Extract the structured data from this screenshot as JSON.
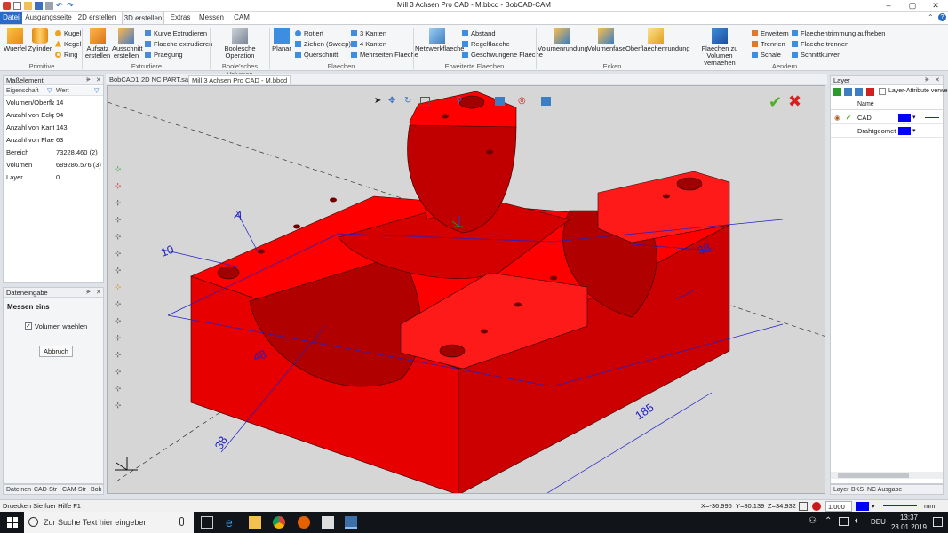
{
  "window": {
    "title": "Mill 3 Achsen Pro CAD - M.bbcd - BobCAD-CAM"
  },
  "ribbon_tabs": [
    "Datei",
    "Ausgangsseite",
    "2D erstellen",
    "3D erstellen",
    "Extras",
    "Messen",
    "CAM"
  ],
  "active_tab": "3D erstellen",
  "ribbon": {
    "primitive": {
      "label": "Primitive",
      "wuerfel": "Wuerfel",
      "zylinder": "Zylinder",
      "kugel": "Kugel",
      "kegel": "Kegel",
      "ring": "Ring"
    },
    "extrudiere": {
      "label": "Extrudiere",
      "aufsatz": "Aufsatz erstellen",
      "ausschnitt": "Ausschnitt erstellen",
      "kurve": "Kurve Extrudieren",
      "flaeche": "Flaeche extrudieren",
      "praegung": "Praegung"
    },
    "boole": {
      "label": "Boole'sches Volumen",
      "op": "Boolesche Operation"
    },
    "flaechen": {
      "label": "Flaechen",
      "planar": "Planar",
      "rotiert": "Rotiert",
      "ziehen": "Ziehen (Sweep)",
      "querschnitt": "Querschnitt",
      "kanten3": "3 Kanten",
      "kanten4": "4 Kanten",
      "mehrseiten": "Mehrseiten Flaeche"
    },
    "erweitert": {
      "label": "Erweiterte Flaechen",
      "netzwerk": "Netzwerkflaeche",
      "abstand": "Abstand",
      "regel": "Regelflaeche",
      "geschwungen": "Geschwungene Flaeche"
    },
    "ecken": {
      "label": "Ecken",
      "volumenrundung": "Volumenrundung",
      "volumenfase": "Volumenfase",
      "oberflaechenrundung": "Oberflaechenrundung"
    },
    "aendern": {
      "label": "Aendern",
      "flaechen_zu_volumen": "Flaechen zu Volumen vernaehen",
      "erweitern": "Erweitern",
      "trennen": "Trennen",
      "schale": "Schale",
      "trimm_aufheben": "Flaechentrimmung aufheben",
      "flaeche_trennen": "Flaeche trennen",
      "schnittkurven": "Schnittkurven"
    }
  },
  "left_panel": {
    "title": "Maßelement",
    "col_property": "Eigenschaft",
    "col_value": "Wert",
    "rows": [
      {
        "k": "Volumen/Oberfla",
        "v": "14"
      },
      {
        "k": "Anzahl von Eckpu",
        "v": "94"
      },
      {
        "k": "Anzahl von Kante",
        "v": "143"
      },
      {
        "k": "Anzahl von Flaecl",
        "v": "63"
      },
      {
        "k": "Bereich",
        "v": "73228.460 (2)"
      },
      {
        "k": "Volumen",
        "v": "689286.576 (3)"
      },
      {
        "k": "Layer",
        "v": "0"
      }
    ]
  },
  "data_entry": {
    "title": "Dateneingabe",
    "heading": "Messen eins",
    "checkbox_label": "Volumen waehlen",
    "checkbox_checked": true,
    "button": "Abbruch"
  },
  "left_bottom_tabs": [
    "Dateinen",
    "CAD-Str",
    "CAM-Str",
    "Bob"
  ],
  "doc_tabs": [
    "BobCAD1",
    "2D NC PART.sat",
    "Mill 3 Achsen Pro CAD - M.bbcd"
  ],
  "viewport": {
    "dims": [
      "A",
      "10",
      "48",
      "38",
      "185",
      "38"
    ]
  },
  "right_panel": {
    "title": "Layer",
    "attr_label": "Layer-Attribute verwe",
    "col_name": "Name",
    "layers": [
      {
        "name": "CAD",
        "color": "#0000ff"
      },
      {
        "name": "Drahtgeomet",
        "color": "#0000ff"
      }
    ]
  },
  "right_bottom_tabs": [
    "Layer",
    "BKS",
    "NC Ausgabe"
  ],
  "status": {
    "hint": "Druecken Sie fuer Hilfe F1",
    "x": "X=-36.996",
    "y": "Y=80.139",
    "z": "Z=34.932",
    "line_width": "1.000",
    "unit": "mm"
  },
  "taskbar": {
    "search": "Zur Suche Text hier eingeben",
    "lang": "DEU",
    "time": "13:37",
    "date": "23.01.2019"
  },
  "colors": {
    "part": "#ff0000",
    "accent": "#2a6cc4"
  }
}
